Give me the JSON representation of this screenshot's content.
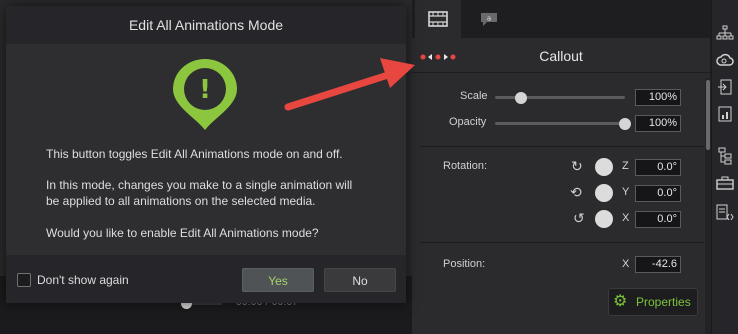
{
  "dialog": {
    "title": "Edit All Animations Mode",
    "para1": "This button toggles Edit All Animations mode on and off.",
    "para2_line1": "In this mode, changes you make to a single animation will",
    "para2_line2": "be applied to all animations on the selected media.",
    "para3": "Would you like to enable Edit All Animations mode?",
    "checkbox_label": "Don't show again",
    "yes_label": "Yes",
    "no_label": "No",
    "warning_glyph": "!"
  },
  "timeline": {
    "timecode": "00:06 / 00:07"
  },
  "panel": {
    "title": "Callout",
    "scale": {
      "label": "Scale",
      "value": "100%",
      "slider_fraction": 0.2
    },
    "opacity": {
      "label": "Opacity",
      "value": "100%",
      "slider_fraction": 1.0
    },
    "rotation": {
      "label": "Rotation:",
      "z": {
        "axis": "Z",
        "value": "0.0°"
      },
      "y": {
        "axis": "Y",
        "value": "0.0°"
      },
      "x": {
        "axis": "X",
        "value": "0.0°"
      }
    },
    "position": {
      "label": "Position:",
      "axis": "X",
      "value": "-42.6"
    },
    "properties_button": "Properties"
  },
  "right_toolbar": [
    "structure-icon",
    "creative-cloud-icon",
    "export-icon",
    "chart-icon",
    "tree-icon",
    "toolbox-icon",
    "code-icon"
  ],
  "colors": {
    "accent_green": "#7bc43a",
    "arrow_red": "#e8473f",
    "warning_green": "#8cc63f"
  }
}
